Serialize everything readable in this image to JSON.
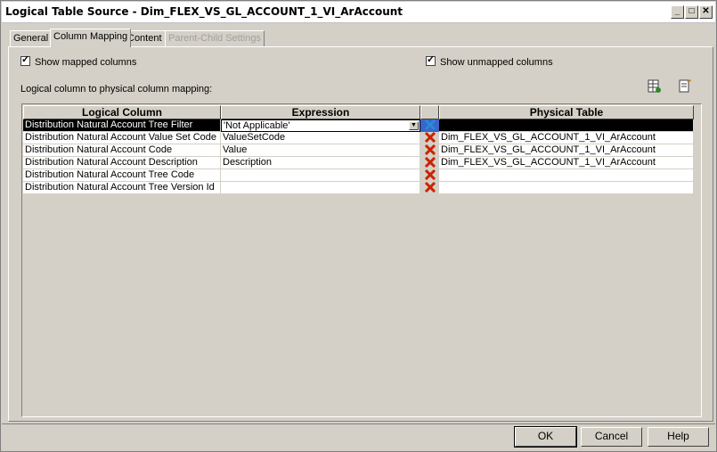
{
  "window": {
    "title": "Logical Table Source - Dim_FLEX_VS_GL_ACCOUNT_1_VI_ArAccount",
    "min_label": "_",
    "max_label": "□",
    "close_label": "✕"
  },
  "tabs": [
    {
      "label": "General",
      "active": false
    },
    {
      "label": "Column Mapping",
      "active": true
    },
    {
      "label": "Content",
      "active": false
    },
    {
      "label": "Parent-Child Settings",
      "disabled": true
    }
  ],
  "options": {
    "show_mapped": {
      "label": "Show mapped columns",
      "checked": true
    },
    "show_unmapped": {
      "label": "Show unmapped columns",
      "checked": true
    },
    "mapping_label": "Logical column to physical column mapping:"
  },
  "grid": {
    "headers": {
      "logical": "Logical Column",
      "expression": "Expression",
      "physical": "Physical Table"
    },
    "rows": [
      {
        "logical": "Distribution Natural Account Tree Filter",
        "expression": "'Not Applicable'",
        "physical": "",
        "selected": true
      },
      {
        "logical": "Distribution Natural Account Value Set Code",
        "expression": "ValueSetCode",
        "physical": "Dim_FLEX_VS_GL_ACCOUNT_1_VI_ArAccount"
      },
      {
        "logical": "Distribution Natural Account Code",
        "expression": "Value",
        "physical": "Dim_FLEX_VS_GL_ACCOUNT_1_VI_ArAccount"
      },
      {
        "logical": "Distribution Natural Account Description",
        "expression": "Description",
        "physical": "Dim_FLEX_VS_GL_ACCOUNT_1_VI_ArAccount"
      },
      {
        "logical": "Distribution Natural Account Tree Code",
        "expression": "",
        "physical": ""
      },
      {
        "logical": "Distribution Natural Account Tree Version Id",
        "expression": "",
        "physical": ""
      }
    ]
  },
  "buttons": {
    "ok": "OK",
    "cancel": "Cancel",
    "help": "Help"
  },
  "icons": {
    "add_column": "table-add-icon",
    "edit": "edit-document-icon",
    "delete": "red-x-delete-icon"
  },
  "colors": {
    "delete_red": "#cc2200",
    "selected_row": "#000000"
  }
}
